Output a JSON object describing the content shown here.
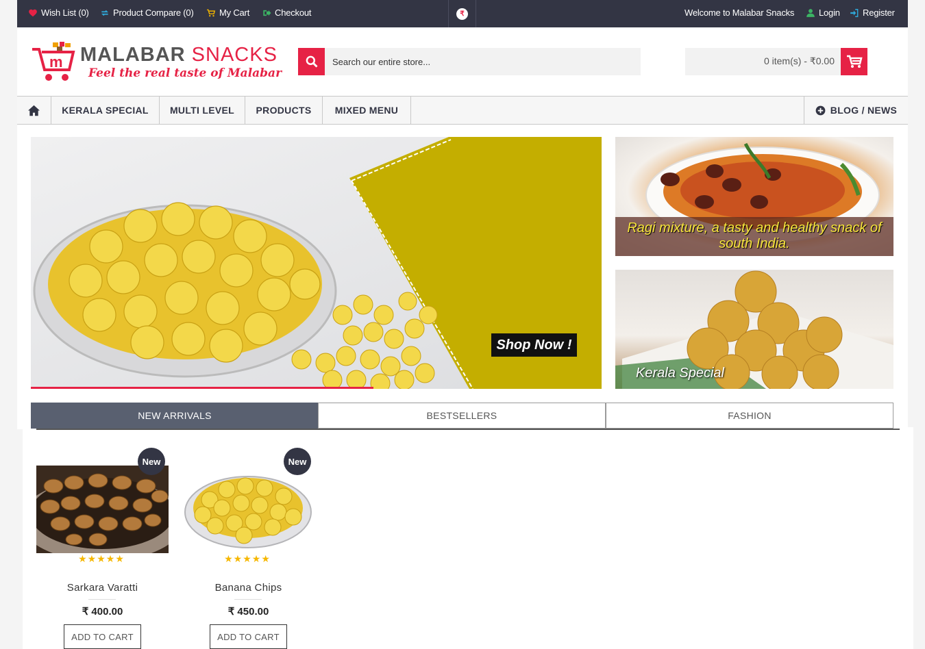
{
  "topbar": {
    "wishlist": "Wish List (0)",
    "compare": "Product Compare (0)",
    "cart": "My Cart",
    "checkout": "Checkout",
    "currency_symbol": "₹",
    "welcome": "Welcome to Malabar Snacks",
    "login": "Login",
    "register": "Register"
  },
  "brand": {
    "name_part1": "MALABAR",
    "name_part2": "SNACKS",
    "tagline": "Feel the real taste of Malabar"
  },
  "search": {
    "placeholder": "Search our entire store..."
  },
  "header_cart": {
    "summary": "0 item(s) - ₹0.00"
  },
  "nav": {
    "items": [
      "KERALA SPECIAL",
      "MULTI LEVEL",
      "PRODUCTS",
      "MIXED MENU"
    ],
    "blog": "BLOG / NEWS"
  },
  "banners": {
    "main_cta": "Shop Now !",
    "side1_caption": "Ragi mixture, a tasty and healthy snack of south India.",
    "side2_caption": "Kerala Special"
  },
  "tabs": [
    {
      "label": "NEW ARRIVALS",
      "active": true
    },
    {
      "label": "BESTSELLERS",
      "active": false
    },
    {
      "label": "FASHION",
      "active": false
    }
  ],
  "products": [
    {
      "name": "Sarkara Varatti",
      "price": "₹ 400.00",
      "badge": "New",
      "rating": 5,
      "add_label": "ADD TO CART"
    },
    {
      "name": "Banana Chips",
      "price": "₹ 450.00",
      "badge": "New",
      "rating": 5,
      "add_label": "ADD TO CART"
    }
  ],
  "colors": {
    "accent": "#e62245",
    "topbar_bg": "#333544",
    "active_tab": "#596070",
    "banner_panel": "#c4ae00",
    "star": "#f6b700"
  }
}
